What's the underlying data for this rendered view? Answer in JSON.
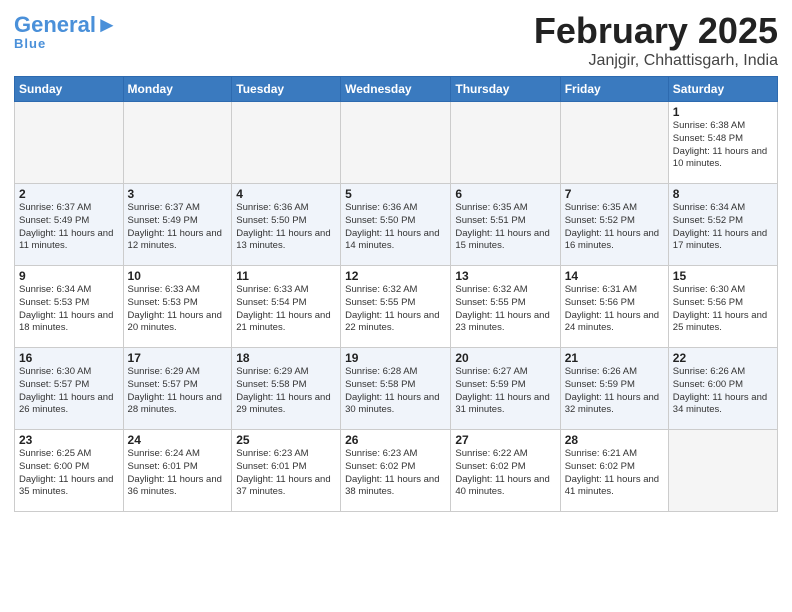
{
  "logo": {
    "general": "General",
    "blue": "Blue"
  },
  "title": "February 2025",
  "location": "Janjgir, Chhattisgarh, India",
  "days_of_week": [
    "Sunday",
    "Monday",
    "Tuesday",
    "Wednesday",
    "Thursday",
    "Friday",
    "Saturday"
  ],
  "weeks": [
    [
      {
        "day": "",
        "info": ""
      },
      {
        "day": "",
        "info": ""
      },
      {
        "day": "",
        "info": ""
      },
      {
        "day": "",
        "info": ""
      },
      {
        "day": "",
        "info": ""
      },
      {
        "day": "",
        "info": ""
      },
      {
        "day": "1",
        "info": "Sunrise: 6:38 AM\nSunset: 5:48 PM\nDaylight: 11 hours\nand 10 minutes."
      }
    ],
    [
      {
        "day": "2",
        "info": "Sunrise: 6:37 AM\nSunset: 5:49 PM\nDaylight: 11 hours\nand 11 minutes."
      },
      {
        "day": "3",
        "info": "Sunrise: 6:37 AM\nSunset: 5:49 PM\nDaylight: 11 hours\nand 12 minutes."
      },
      {
        "day": "4",
        "info": "Sunrise: 6:36 AM\nSunset: 5:50 PM\nDaylight: 11 hours\nand 13 minutes."
      },
      {
        "day": "5",
        "info": "Sunrise: 6:36 AM\nSunset: 5:50 PM\nDaylight: 11 hours\nand 14 minutes."
      },
      {
        "day": "6",
        "info": "Sunrise: 6:35 AM\nSunset: 5:51 PM\nDaylight: 11 hours\nand 15 minutes."
      },
      {
        "day": "7",
        "info": "Sunrise: 6:35 AM\nSunset: 5:52 PM\nDaylight: 11 hours\nand 16 minutes."
      },
      {
        "day": "8",
        "info": "Sunrise: 6:34 AM\nSunset: 5:52 PM\nDaylight: 11 hours\nand 17 minutes."
      }
    ],
    [
      {
        "day": "9",
        "info": "Sunrise: 6:34 AM\nSunset: 5:53 PM\nDaylight: 11 hours\nand 18 minutes."
      },
      {
        "day": "10",
        "info": "Sunrise: 6:33 AM\nSunset: 5:53 PM\nDaylight: 11 hours\nand 20 minutes."
      },
      {
        "day": "11",
        "info": "Sunrise: 6:33 AM\nSunset: 5:54 PM\nDaylight: 11 hours\nand 21 minutes."
      },
      {
        "day": "12",
        "info": "Sunrise: 6:32 AM\nSunset: 5:55 PM\nDaylight: 11 hours\nand 22 minutes."
      },
      {
        "day": "13",
        "info": "Sunrise: 6:32 AM\nSunset: 5:55 PM\nDaylight: 11 hours\nand 23 minutes."
      },
      {
        "day": "14",
        "info": "Sunrise: 6:31 AM\nSunset: 5:56 PM\nDaylight: 11 hours\nand 24 minutes."
      },
      {
        "day": "15",
        "info": "Sunrise: 6:30 AM\nSunset: 5:56 PM\nDaylight: 11 hours\nand 25 minutes."
      }
    ],
    [
      {
        "day": "16",
        "info": "Sunrise: 6:30 AM\nSunset: 5:57 PM\nDaylight: 11 hours\nand 26 minutes."
      },
      {
        "day": "17",
        "info": "Sunrise: 6:29 AM\nSunset: 5:57 PM\nDaylight: 11 hours\nand 28 minutes."
      },
      {
        "day": "18",
        "info": "Sunrise: 6:29 AM\nSunset: 5:58 PM\nDaylight: 11 hours\nand 29 minutes."
      },
      {
        "day": "19",
        "info": "Sunrise: 6:28 AM\nSunset: 5:58 PM\nDaylight: 11 hours\nand 30 minutes."
      },
      {
        "day": "20",
        "info": "Sunrise: 6:27 AM\nSunset: 5:59 PM\nDaylight: 11 hours\nand 31 minutes."
      },
      {
        "day": "21",
        "info": "Sunrise: 6:26 AM\nSunset: 5:59 PM\nDaylight: 11 hours\nand 32 minutes."
      },
      {
        "day": "22",
        "info": "Sunrise: 6:26 AM\nSunset: 6:00 PM\nDaylight: 11 hours\nand 34 minutes."
      }
    ],
    [
      {
        "day": "23",
        "info": "Sunrise: 6:25 AM\nSunset: 6:00 PM\nDaylight: 11 hours\nand 35 minutes."
      },
      {
        "day": "24",
        "info": "Sunrise: 6:24 AM\nSunset: 6:01 PM\nDaylight: 11 hours\nand 36 minutes."
      },
      {
        "day": "25",
        "info": "Sunrise: 6:23 AM\nSunset: 6:01 PM\nDaylight: 11 hours\nand 37 minutes."
      },
      {
        "day": "26",
        "info": "Sunrise: 6:23 AM\nSunset: 6:02 PM\nDaylight: 11 hours\nand 38 minutes."
      },
      {
        "day": "27",
        "info": "Sunrise: 6:22 AM\nSunset: 6:02 PM\nDaylight: 11 hours\nand 40 minutes."
      },
      {
        "day": "28",
        "info": "Sunrise: 6:21 AM\nSunset: 6:02 PM\nDaylight: 11 hours\nand 41 minutes."
      },
      {
        "day": "",
        "info": ""
      }
    ]
  ]
}
